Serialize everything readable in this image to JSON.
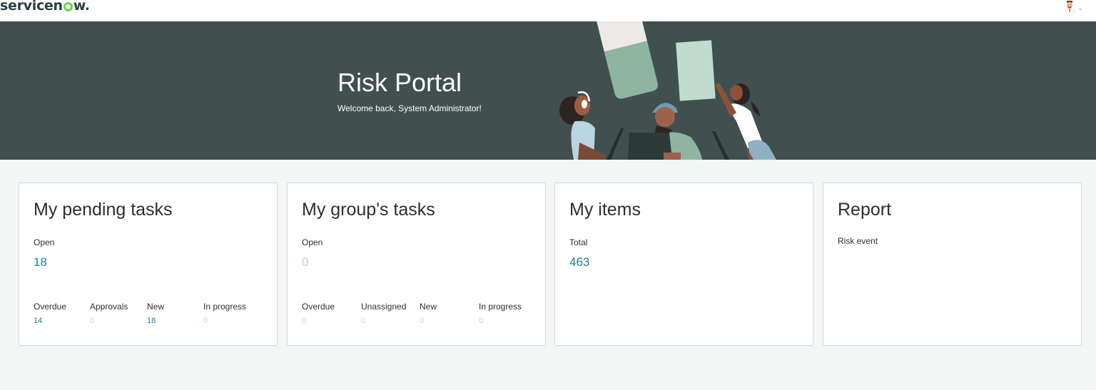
{
  "brand": {
    "logo_prefix": "servicen",
    "logo_suffix": "w.",
    "accent": "#62d84e",
    "logo_color": "#293e40"
  },
  "header": {
    "user_menu_icon": "chevron-down-icon"
  },
  "hero": {
    "title": "Risk Portal",
    "subtitle": "Welcome back, System Administrator!",
    "background": "#414f4f"
  },
  "cards": [
    {
      "title": "My pending tasks",
      "primary_label": "Open",
      "primary_value": "18",
      "sub_metrics": [
        {
          "label": "Overdue",
          "value": "14"
        },
        {
          "label": "Approvals",
          "value": "0"
        },
        {
          "label": "New",
          "value": "18"
        },
        {
          "label": "In progress",
          "value": "0"
        }
      ]
    },
    {
      "title": "My group's tasks",
      "primary_label": "Open",
      "primary_value": "0",
      "sub_metrics": [
        {
          "label": "Overdue",
          "value": "0"
        },
        {
          "label": "Unassigned",
          "value": "0"
        },
        {
          "label": "New",
          "value": "0"
        },
        {
          "label": "In progress",
          "value": "0"
        }
      ]
    },
    {
      "title": "My items",
      "primary_label": "Total",
      "primary_value": "463"
    },
    {
      "title": "Report",
      "link_label": "Risk event"
    }
  ],
  "colors": {
    "link": "#1f7e8c",
    "link_zero": "#a9d6dd",
    "card_border": "#d6d9d9",
    "page_bg": "#f4f5f5"
  }
}
